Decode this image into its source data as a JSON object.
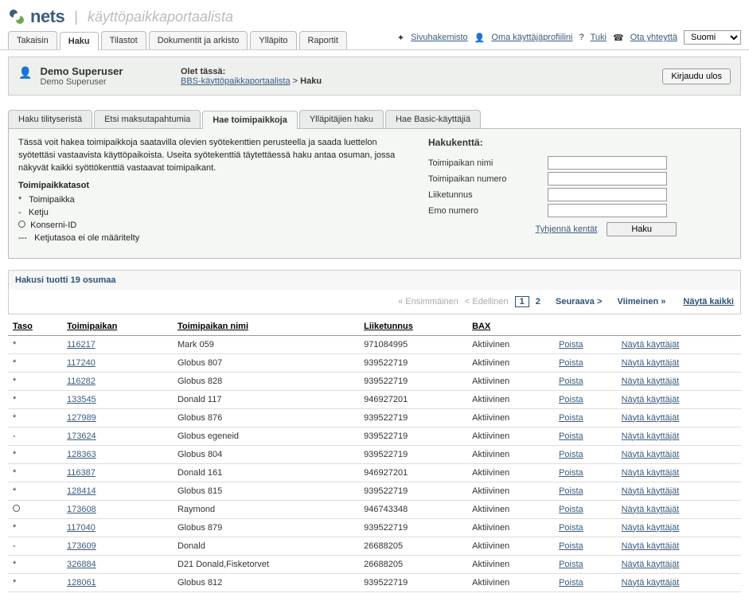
{
  "header": {
    "brand": "nets",
    "portal_name": "käyttöpaikkaportaalista"
  },
  "main_tabs": [
    {
      "label": "Takaisin"
    },
    {
      "label": "Haku",
      "active": true
    },
    {
      "label": "Tilastot"
    },
    {
      "label": "Dokumentit ja arkisto"
    },
    {
      "label": "Ylläpito"
    },
    {
      "label": "Raportit"
    }
  ],
  "top_links": {
    "sitemap": "Sivuhakemisto",
    "profile": "Oma käyttäjäprofiilini",
    "help_prefix": "?",
    "help": "Tuki",
    "contact": "Ota yhteyttä",
    "language": "Suomi"
  },
  "userbar": {
    "display_name": "Demo Superuser",
    "sub_name": "Demo Superuser",
    "you_are_here": "Olet tässä:",
    "breadcrumb_root": "BBS-käyttöpaikkaportaalista",
    "breadcrumb_sep": ">",
    "breadcrumb_leaf": "Haku",
    "logout": "Kirjaudu ulos"
  },
  "sub_tabs": [
    {
      "label": "Haku tilityseristä"
    },
    {
      "label": "Etsi maksutapahtumia"
    },
    {
      "label": "Hae toimipaikkoja",
      "active": true
    },
    {
      "label": "Ylläpitäjien haku"
    },
    {
      "label": "Hae Basic-käyttäjiä"
    }
  ],
  "panel_left": {
    "intro": "Tässä voit hakea toimipaikkoja saatavilla olevien syötekenttien perusteella ja saada luettelon syötettäsi vastaavista käyttöpaikoista. Useita syötekenttiä täytettäessä haku antaa osuman, jossa näkyvät kaikki syöttökenttiä vastaavat toimipaikant.",
    "levels_title": "Toimipaikkatasot",
    "levels": [
      {
        "sym": "*",
        "label": "Toimipaikka"
      },
      {
        "sym": "-",
        "label": "Ketju"
      },
      {
        "sym": "circle",
        "label": "Konserni-ID"
      },
      {
        "sym": "---",
        "label": "Ketjutasoa ei ole määritelty"
      }
    ]
  },
  "panel_right": {
    "title": "Hakukenttä:",
    "fields": [
      {
        "label": "Toimipaikan nimi",
        "name": "merchant-name"
      },
      {
        "label": "Toimipaikan numero",
        "name": "merchant-number"
      },
      {
        "label": "Liiketunnus",
        "name": "business-id"
      },
      {
        "label": "Emo numero",
        "name": "parent-number"
      }
    ],
    "clear": "Tyhjennä kentät",
    "search": "Haku"
  },
  "results": {
    "summary": "Hakusi tuotti 19 osumaa",
    "paginator": {
      "first": "« Ensimmäinen",
      "prev": "< Edellinen",
      "page1": "1",
      "page2": "2",
      "next": "Seuraava >",
      "last": "Viimeinen »",
      "show_all": "Näytä kaikki"
    },
    "columns": {
      "level": "Taso",
      "merchant": "Toimipaikan",
      "merchant_name": "Toimipaikan nimi",
      "business_id": "Liiketunnus",
      "bax": "BAX"
    },
    "actions": {
      "remove": "Poista",
      "show_users": "Näytä käyttäjät"
    },
    "rows": [
      {
        "level": "*",
        "merchant": "116217",
        "name": "Mark 059",
        "business": "971084995",
        "bax": "Aktiivinen"
      },
      {
        "level": "*",
        "merchant": "117240",
        "name": "Globus 807",
        "business": "939522719",
        "bax": "Aktiivinen"
      },
      {
        "level": "*",
        "merchant": "116282",
        "name": "Globus 828",
        "business": "939522719",
        "bax": "Aktiivinen"
      },
      {
        "level": "*",
        "merchant": "133545",
        "name": "Donald 117",
        "business": "946927201",
        "bax": "Aktiivinen"
      },
      {
        "level": "*",
        "merchant": "127989",
        "name": "Globus 876",
        "business": "939522719",
        "bax": "Aktiivinen"
      },
      {
        "level": "-",
        "merchant": "173624",
        "name": "Globus egeneid",
        "business": "939522719",
        "bax": "Aktiivinen"
      },
      {
        "level": "*",
        "merchant": "128363",
        "name": "Globus 804",
        "business": "939522719",
        "bax": "Aktiivinen"
      },
      {
        "level": "*",
        "merchant": "116387",
        "name": "Donald 161",
        "business": "946927201",
        "bax": "Aktiivinen"
      },
      {
        "level": "*",
        "merchant": "128414",
        "name": "Globus 815",
        "business": "939522719",
        "bax": "Aktiivinen"
      },
      {
        "level": "circle",
        "merchant": "173608",
        "name": "Raymond",
        "business": "946743348",
        "bax": "Aktiivinen"
      },
      {
        "level": "*",
        "merchant": "117040",
        "name": "Globus 879",
        "business": "939522719",
        "bax": "Aktiivinen"
      },
      {
        "level": "-",
        "merchant": "173609",
        "name": "Donald",
        "business": "26688205",
        "bax": "Aktiivinen"
      },
      {
        "level": "*",
        "merchant": "326884",
        "name": "D21 Donald,Fisketorvet",
        "business": "26688205",
        "bax": "Aktiivinen"
      },
      {
        "level": "*",
        "merchant": "128061",
        "name": "Globus 812",
        "business": "939522719",
        "bax": "Aktiivinen"
      }
    ]
  }
}
